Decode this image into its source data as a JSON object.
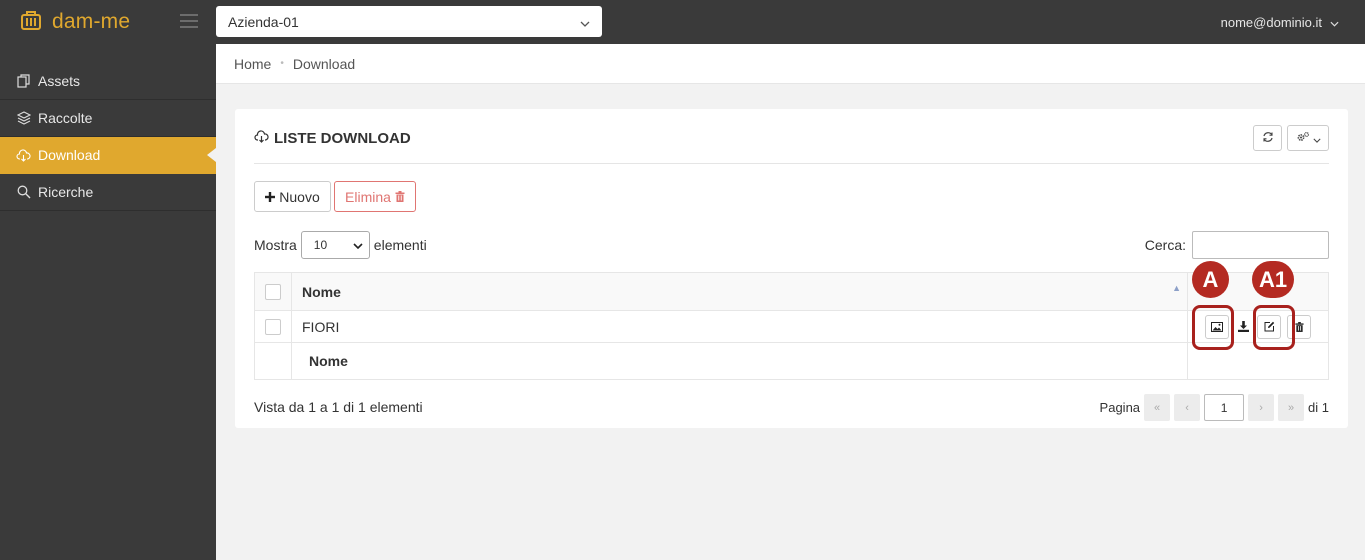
{
  "app": {
    "brand": "dam-me"
  },
  "header": {
    "company_select_value": "Azienda-01",
    "user_email": "nome@dominio.it"
  },
  "sidebar": {
    "items": [
      {
        "label": "Assets",
        "icon": "files-icon",
        "active": false
      },
      {
        "label": "Raccolte",
        "icon": "layers-icon",
        "active": false
      },
      {
        "label": "Download",
        "icon": "cloud-download-icon",
        "active": true
      },
      {
        "label": "Ricerche",
        "icon": "search-icon",
        "active": false
      }
    ]
  },
  "breadcrumb": {
    "items": [
      "Home",
      "Download"
    ]
  },
  "panel": {
    "title": "LISTE DOWNLOAD",
    "new_button": "Nuovo",
    "delete_button": "Elimina",
    "show_label": "Mostra",
    "page_length_value": "10",
    "entries_label": "elementi",
    "search_label": "Cerca:"
  },
  "table": {
    "header_column": "Nome",
    "rows": [
      {
        "name": "FIORI"
      }
    ],
    "footer_column": "Nome"
  },
  "annotations": {
    "marker_a": "A",
    "marker_a1": "A1"
  },
  "footer": {
    "info": "Vista da 1 a 1 di 1 elementi",
    "page_label": "Pagina",
    "first": "«",
    "prev": "‹",
    "current_page": "1",
    "next": "›",
    "last": "»",
    "total_pages": "di 1"
  },
  "colors": {
    "accent": "#e0a82e",
    "sidebar_bg": "#3a3a3a",
    "danger": "#d9534f",
    "marker": "#b42a22"
  }
}
